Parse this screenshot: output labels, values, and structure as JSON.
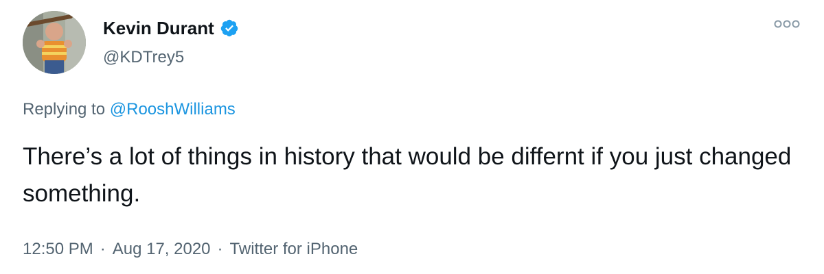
{
  "author": {
    "display_name": "Kevin Durant",
    "handle": "@KDTrey5",
    "verified": true,
    "verified_color": "#1da1f2"
  },
  "reply": {
    "prefix": "Replying to",
    "mention": "@RooshWilliams",
    "mention_color": "#1b95e0"
  },
  "tweet": {
    "text": "There’s a lot of things in history that would be differnt if you just changed something."
  },
  "meta": {
    "time": "12:50 PM",
    "separator": "·",
    "date": "Aug 17, 2020",
    "source": "Twitter for iPhone"
  },
  "icons": {
    "more": "more-options-icon",
    "verified": "verified-badge-icon"
  }
}
